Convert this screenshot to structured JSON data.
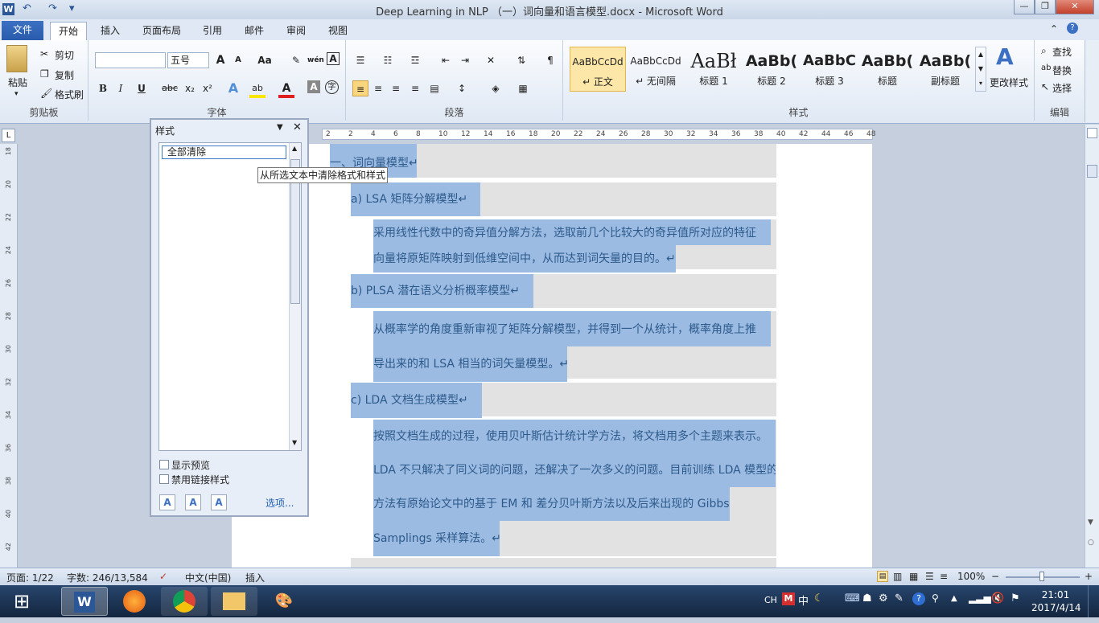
{
  "window": {
    "title": "Deep Learning in NLP （一）词向量和语言模型.docx  -  Microsoft Word",
    "app_icon": "W",
    "minimize_label": "—",
    "maximize_label": "❐",
    "close_label": "✕"
  },
  "quick_access": {
    "undo_label": "↶",
    "redo_label": "↷",
    "customize_label": "▾"
  },
  "tabs": [
    {
      "label": "文件"
    },
    {
      "label": "开始"
    },
    {
      "label": "插入"
    },
    {
      "label": "页面布局"
    },
    {
      "label": "引用"
    },
    {
      "label": "邮件"
    },
    {
      "label": "审阅"
    },
    {
      "label": "视图"
    }
  ],
  "ribbon": {
    "clipboard": {
      "group_label": "剪贴板",
      "paste": "粘贴",
      "cut": "剪切",
      "copy": "复制",
      "format_painter": "格式刷"
    },
    "font": {
      "group_label": "字体",
      "font_name": "",
      "font_size": "五号",
      "grow": "A",
      "shrink": "A",
      "change_case": "Aa",
      "clear_format": "✎",
      "phonetic": "wén",
      "char_border": "A",
      "bold": "B",
      "italic": "I",
      "underline": "U",
      "strike": "abc",
      "subscript": "x₂",
      "superscript": "x²",
      "text_effect": "A",
      "highlight": "ab",
      "font_color": "A",
      "char_shading": "A",
      "enclose": "字"
    },
    "paragraph": {
      "group_label": "段落"
    },
    "styles": {
      "group_label": "样式",
      "change_styles": "更改样式",
      "items": [
        {
          "sample": "AaBbCcDd",
          "name": "↵ 正文"
        },
        {
          "sample": "AaBbCcDd",
          "name": "↵ 无间隔"
        },
        {
          "sample": "AaBł",
          "name": "标题 1"
        },
        {
          "sample": "AaBb(",
          "name": "标题 2"
        },
        {
          "sample": "AaBbC",
          "name": "标题 3"
        },
        {
          "sample": "AaBb(",
          "name": "标题"
        },
        {
          "sample": "AaBb(",
          "name": "副标题"
        }
      ]
    },
    "editing": {
      "group_label": "编辑",
      "find": "查找",
      "replace": "替换",
      "select": "选择"
    }
  },
  "ruler": {
    "marks": [
      "2",
      "2",
      "4",
      "6",
      "8",
      "10",
      "12",
      "14",
      "16",
      "18",
      "20",
      "22",
      "24",
      "26",
      "28",
      "30",
      "32",
      "34",
      "36",
      "38",
      "40",
      "42",
      "44",
      "46",
      "48"
    ],
    "vmarks": [
      "18",
      "20",
      "22",
      "24",
      "26",
      "28",
      "30",
      "32",
      "34",
      "36",
      "38",
      "40",
      "42"
    ]
  },
  "document": {
    "lines": [
      "一、词向量模型↵",
      "a)     LSA 矩阵分解模型↵",
      "    采用线性代数中的奇异值分解方法，选取前几个比较大的奇异值所对应的特征",
      "向量将原矩阵映射到低维空间中，从而达到词矢量的目的。↵",
      "b)     PLSA 潜在语义分析概率模型↵",
      "    从概率学的角度重新审视了矩阵分解模型，并得到一个从统计，概率角度上推",
      "导出来的和 LSA 相当的词矢量模型。↵",
      "c)     LDA 文档生成模型↵",
      "    按照文档生成的过程，使用贝叶斯估计统计学方法，将文档用多个主题来表示。",
      "LDA 不只解决了同义词的问题，还解决了一次多义的问题。目前训练 LDA 模型的",
      "方法有原始论文中的基于 EM 和 差分贝叶斯方法以及后来出现的 Gibbs",
      "Samplings 采样算法。↵"
    ]
  },
  "styles_pane": {
    "title": "样式",
    "list_item": "全部清除",
    "tooltip": "从所选文本中清除格式和样式",
    "show_preview": "显示预览",
    "disable_linked": "禁用链接样式",
    "options_link": "选项..."
  },
  "status": {
    "page": "页面: 1/22",
    "words": "字数: 246/13,584",
    "language": "中文(中国)",
    "mode": "插入",
    "zoom": "100%",
    "zoom_minus": "−",
    "zoom_plus": "+"
  },
  "taskbar": {
    "start": "⊞",
    "tray_ime": "CH",
    "tray_lang": "中",
    "time": "21:01",
    "date": "2017/4/14"
  },
  "colors": {
    "selection": "#9cbbe3",
    "file_tab": "#2a5bac",
    "ribbon_bg": "#dfe8f4",
    "taskbar": "#1c3454"
  }
}
